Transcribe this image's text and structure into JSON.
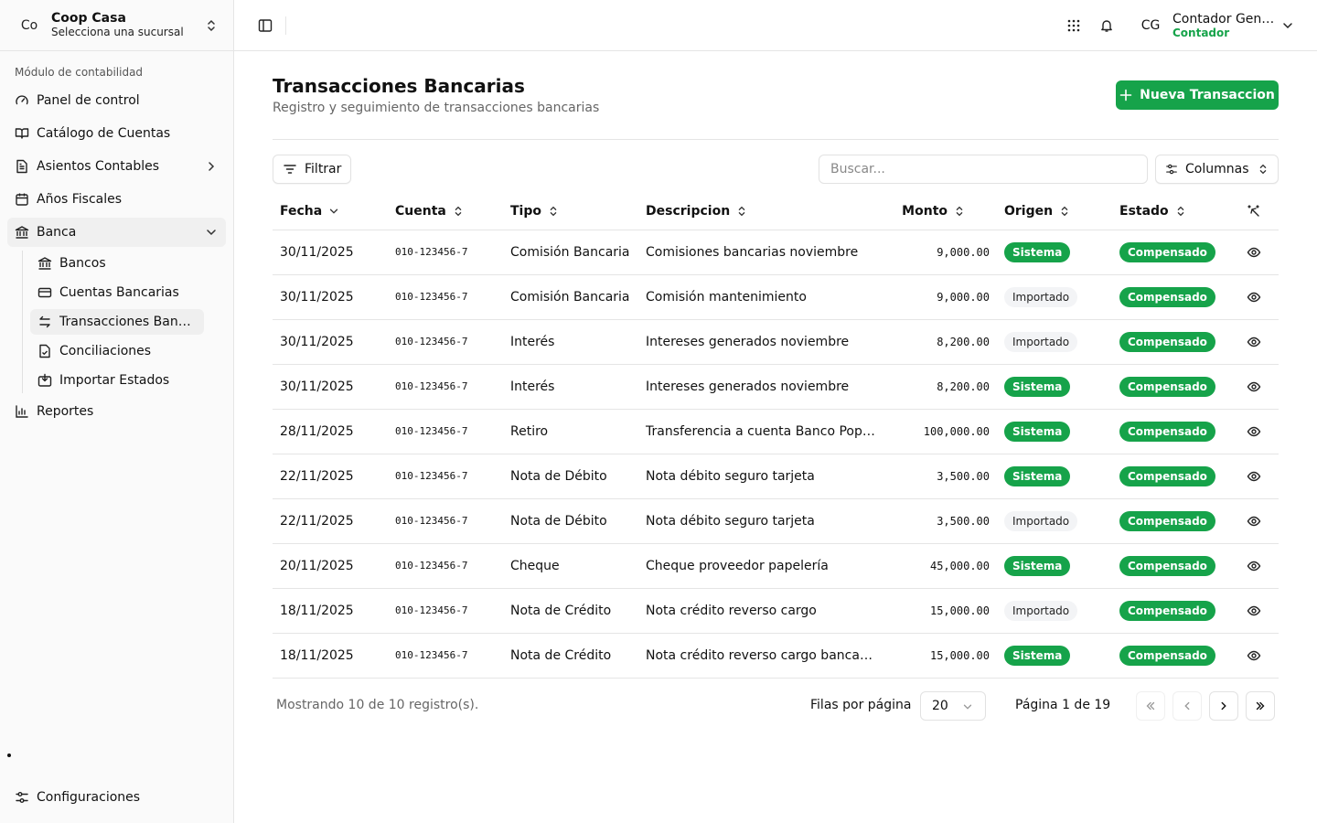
{
  "sidebar": {
    "org": {
      "avatar": "Co",
      "name": "Coop Casa",
      "subtitle": "Selecciona una sucursal"
    },
    "section_label": "Módulo de contabilidad",
    "items": [
      {
        "label": "Panel de control",
        "icon": "gauge-icon"
      },
      {
        "label": "Catálogo de Cuentas",
        "icon": "book-icon"
      },
      {
        "label": "Asientos Contables",
        "icon": "file-text-icon"
      },
      {
        "label": "Años Fiscales",
        "icon": "calendar-icon"
      },
      {
        "label": "Banca",
        "icon": "landmark-icon"
      },
      {
        "label": "Reportes",
        "icon": "bar-chart-icon"
      }
    ],
    "banca_sub": [
      {
        "label": "Bancos",
        "icon": "landmark-icon"
      },
      {
        "label": "Cuentas Bancarias",
        "icon": "credit-card-icon"
      },
      {
        "label": "Transacciones Bancarias",
        "icon": "arrows-exchange-icon"
      },
      {
        "label": "Conciliaciones",
        "icon": "file-check-icon"
      },
      {
        "label": "Importar Estados",
        "icon": "import-icon"
      }
    ],
    "settings_label": "Configuraciones"
  },
  "header": {
    "user": {
      "initials": "CG",
      "name": "Contador General",
      "role": "Contador"
    }
  },
  "page": {
    "title": "Transacciones Bancarias",
    "subtitle": "Registro y seguimiento de transacciones bancarias",
    "new_button": "Nueva Transaccion",
    "filter_button": "Filtrar",
    "search_placeholder": "Buscar...",
    "columns_button": "Columnas"
  },
  "table": {
    "headers": [
      "Fecha",
      "Cuenta",
      "Tipo",
      "Descripcion",
      "Monto",
      "Origen",
      "Estado"
    ],
    "rows": [
      {
        "fecha": "30/11/2025",
        "cuenta": "010-123456-7",
        "tipo": "Comisión Bancaria",
        "descripcion": "Comisiones bancarias noviembre",
        "monto": "9,000.00",
        "origen": "Sistema",
        "estado": "Compensado"
      },
      {
        "fecha": "30/11/2025",
        "cuenta": "010-123456-7",
        "tipo": "Comisión Bancaria",
        "descripcion": "Comisión mantenimiento",
        "monto": "9,000.00",
        "origen": "Importado",
        "estado": "Compensado"
      },
      {
        "fecha": "30/11/2025",
        "cuenta": "010-123456-7",
        "tipo": "Interés",
        "descripcion": "Intereses generados noviembre",
        "monto": "8,200.00",
        "origen": "Importado",
        "estado": "Compensado"
      },
      {
        "fecha": "30/11/2025",
        "cuenta": "010-123456-7",
        "tipo": "Interés",
        "descripcion": "Intereses generados noviembre",
        "monto": "8,200.00",
        "origen": "Sistema",
        "estado": "Compensado"
      },
      {
        "fecha": "28/11/2025",
        "cuenta": "010-123456-7",
        "tipo": "Retiro",
        "descripcion": "Transferencia a cuenta Banco Popular",
        "monto": "100,000.00",
        "origen": "Sistema",
        "estado": "Compensado"
      },
      {
        "fecha": "22/11/2025",
        "cuenta": "010-123456-7",
        "tipo": "Nota de Débito",
        "descripcion": "Nota débito seguro tarjeta",
        "monto": "3,500.00",
        "origen": "Sistema",
        "estado": "Compensado"
      },
      {
        "fecha": "22/11/2025",
        "cuenta": "010-123456-7",
        "tipo": "Nota de Débito",
        "descripcion": "Nota débito seguro tarjeta",
        "monto": "3,500.00",
        "origen": "Importado",
        "estado": "Compensado"
      },
      {
        "fecha": "20/11/2025",
        "cuenta": "010-123456-7",
        "tipo": "Cheque",
        "descripcion": "Cheque proveedor papelería",
        "monto": "45,000.00",
        "origen": "Sistema",
        "estado": "Compensado"
      },
      {
        "fecha": "18/11/2025",
        "cuenta": "010-123456-7",
        "tipo": "Nota de Crédito",
        "descripcion": "Nota crédito reverso cargo",
        "monto": "15,000.00",
        "origen": "Importado",
        "estado": "Compensado"
      },
      {
        "fecha": "18/11/2025",
        "cuenta": "010-123456-7",
        "tipo": "Nota de Crédito",
        "descripcion": "Nota crédito reverso cargo bancario",
        "monto": "15,000.00",
        "origen": "Sistema",
        "estado": "Compensado"
      }
    ]
  },
  "pagination": {
    "showing": "Mostrando 10 de 10 registro(s).",
    "rows_label": "Filas por página",
    "rows_value": "20",
    "page_label": "Página 1 de 19"
  },
  "colors": {
    "accent": "#16a34a",
    "muted": "#666666",
    "border": "#e5e5e5"
  }
}
